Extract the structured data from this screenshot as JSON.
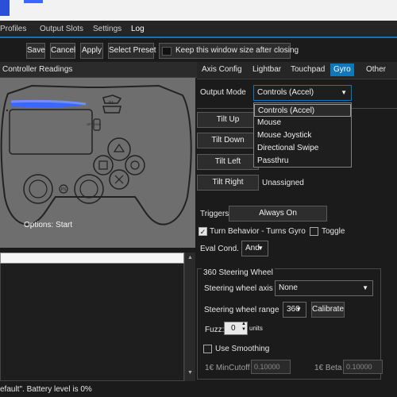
{
  "menu": {
    "items": [
      "Profiles",
      "Output Slots",
      "Settings",
      "Log"
    ],
    "active": "Log"
  },
  "toolbar": {
    "save": "Save",
    "cancel": "Cancel",
    "apply": "Apply",
    "select_preset": "Select Preset",
    "keep_window": "Keep this window size after closing"
  },
  "left": {
    "header": "Controller Readings",
    "controller_status": "Options: Start"
  },
  "tabs": [
    "Axis Config",
    "Lightbar",
    "Touchpad",
    "Gyro",
    "Other"
  ],
  "active_tab": "Gyro",
  "gyro": {
    "output_mode_label": "Output Mode",
    "output_mode_value": "Controls (Accel)",
    "output_mode_options": [
      "Controls (Accel)",
      "Mouse",
      "Mouse Joystick",
      "Directional Swipe",
      "Passthru"
    ],
    "tilt_up": "Tilt Up",
    "tilt_down": "Tilt Down",
    "tilt_left": "Tilt Left",
    "tilt_right": "Tilt Right",
    "tilt_right_value": "Unassigned",
    "triggers_label": "Triggers",
    "triggers_value": "Always On",
    "turn_behavior": "Turn Behavior - Turns Gyro",
    "toggle": "Toggle",
    "eval_cond_label": "Eval Cond.",
    "eval_cond_value": "And"
  },
  "steering": {
    "group_title": "360 Steering Wheel",
    "axis_label": "Steering wheel axis",
    "axis_value": "None",
    "range_label": "Steering wheel range",
    "range_value": "360",
    "calibrate": "Calibrate",
    "fuzz_label": "Fuzz:",
    "fuzz_value": "0",
    "fuzz_unit": "units",
    "use_smoothing": "Use Smoothing",
    "min_cutoff_label": "1€ MinCutoff",
    "min_cutoff_value": "0.10000",
    "beta_label": "1€ Beta",
    "beta_value": "0.10000"
  },
  "status": {
    "text": "efault\". Battery level is 0%"
  },
  "colors": {
    "accent": "#1177bb",
    "lightbar": "#3a67ff"
  }
}
